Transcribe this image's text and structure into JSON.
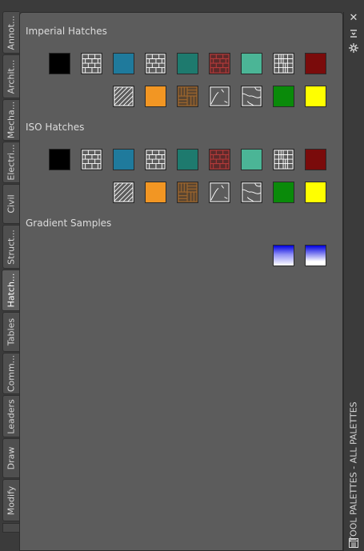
{
  "tabs": [
    {
      "label": "Annot..."
    },
    {
      "label": "Archit..."
    },
    {
      "label": "Mecha..."
    },
    {
      "label": "Electri..."
    },
    {
      "label": "Civil"
    },
    {
      "label": "Struct..."
    },
    {
      "label": "Hatch..."
    },
    {
      "label": "Tables"
    },
    {
      "label": "Comm..."
    },
    {
      "label": "Leaders"
    },
    {
      "label": "Draw"
    },
    {
      "label": "Modify"
    }
  ],
  "active_tab": "Hatch...",
  "sections": [
    {
      "title": "Imperial Hatches"
    },
    {
      "title": "ISO Hatches"
    },
    {
      "title": "Gradient Samples"
    }
  ],
  "palette_title": "TOOL PALETTES - ALL PALETTES",
  "swatch_row1": [
    "solid-black",
    "brick-white",
    "solid-blue",
    "brick-white",
    "solid-teal",
    "brick-red",
    "solid-aqua",
    "grid-white",
    "solid-darkred"
  ],
  "swatch_row2": [
    "diagonal-white",
    "solid-orange",
    "parquet-brown",
    "curve-white",
    "earth-white",
    "solid-green",
    "solid-yellow"
  ],
  "gradients": [
    "gradient-blue-1",
    "gradient-blue-2"
  ],
  "colors": {
    "black": "#000000",
    "blue": "#1f7a9c",
    "teal": "#1e7a6e",
    "aqua": "#4bb596",
    "darkred": "#7a0b0b",
    "orange": "#f29623",
    "brown": "#8a5a2b",
    "green": "#0a8a0a",
    "yellow": "#ffff00",
    "brickred": "#8b2a2a",
    "gradient_top": "#0000e0",
    "gradient_bottom": "#ffffff"
  },
  "icons": [
    "close-icon",
    "pin-icon",
    "settings-icon",
    "properties-icon"
  ]
}
